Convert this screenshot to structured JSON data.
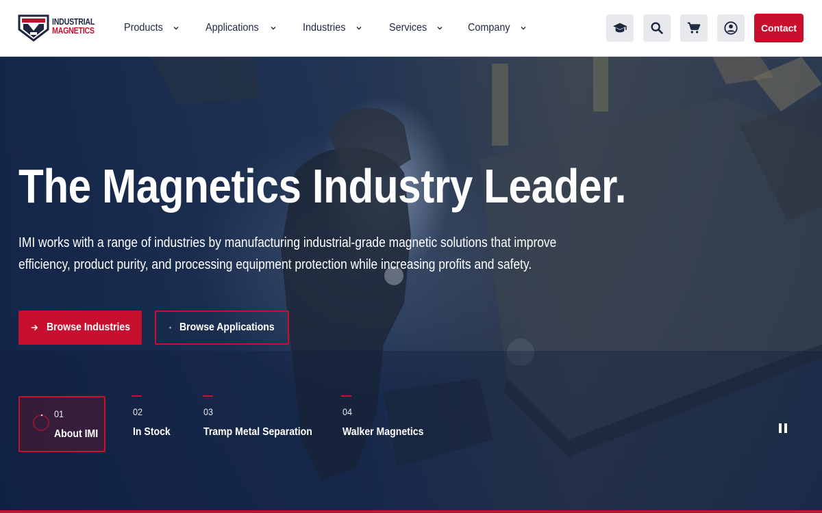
{
  "brand": {
    "line1": "INDUSTRIAL",
    "line2": "MAGNETICS"
  },
  "nav": [
    {
      "label": "Products"
    },
    {
      "label": "Applications"
    },
    {
      "label": "Industries"
    },
    {
      "label": "Services"
    },
    {
      "label": "Company"
    }
  ],
  "header_icons": [
    "graduation-cap-icon",
    "search-icon",
    "cart-icon",
    "account-icon"
  ],
  "contact_label": "Contact",
  "hero": {
    "title": "The Magnetics Industry Leader.",
    "description": "IMI works with a range of industries by manufacturing industrial-grade magnetic solutions that improve efficiency, product purity, and processing equipment protection while increasing profits and safety.",
    "primary_button": "Browse Industries",
    "secondary_button": "Browse Applications"
  },
  "slides": [
    {
      "num": "01",
      "label": "About IMI",
      "active": true
    },
    {
      "num": "02",
      "label": "In Stock"
    },
    {
      "num": "03",
      "label": "Tramp Metal Separation"
    },
    {
      "num": "04",
      "label": "Walker Magnetics"
    }
  ],
  "colors": {
    "accent": "#c8102e",
    "navy": "#1d2740",
    "icon_bg": "#e7e9ed"
  }
}
